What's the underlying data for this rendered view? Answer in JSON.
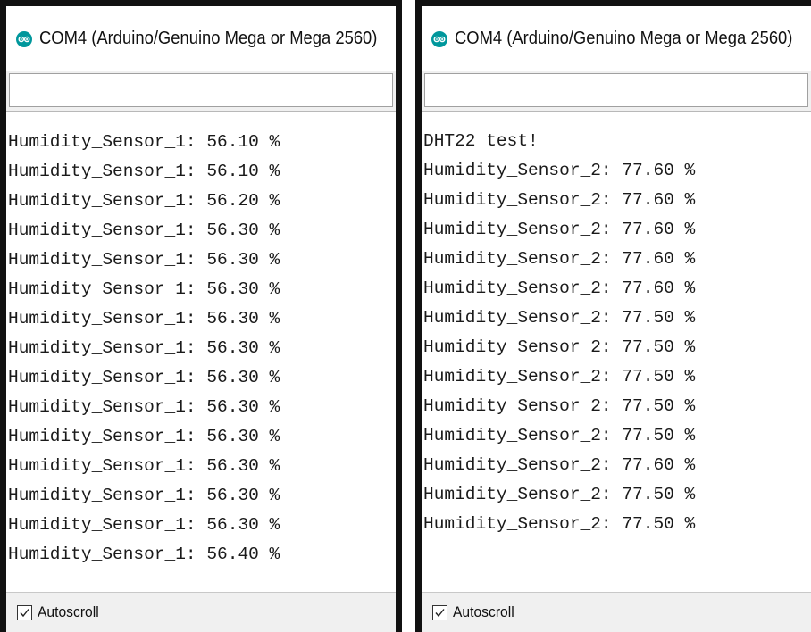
{
  "windows": [
    {
      "title": "COM4 (Arduino/Genuino Mega or Mega 2560)",
      "send_value": "",
      "autoscroll_label": "Autoscroll",
      "autoscroll_checked": true,
      "partial_line": "Humidity_Sensor_1: 56.10 %",
      "lines": [
        "Humidity_Sensor_1: 56.10 %",
        "Humidity_Sensor_1: 56.10 %",
        "Humidity_Sensor_1: 56.20 %",
        "Humidity_Sensor_1: 56.30 %",
        "Humidity_Sensor_1: 56.30 %",
        "Humidity_Sensor_1: 56.30 %",
        "Humidity_Sensor_1: 56.30 %",
        "Humidity_Sensor_1: 56.30 %",
        "Humidity_Sensor_1: 56.30 %",
        "Humidity_Sensor_1: 56.30 %",
        "Humidity_Sensor_1: 56.30 %",
        "Humidity_Sensor_1: 56.30 %",
        "Humidity_Sensor_1: 56.30 %",
        "Humidity_Sensor_1: 56.30 %",
        "Humidity_Sensor_1: 56.40 %"
      ]
    },
    {
      "title": "COM4 (Arduino/Genuino Mega or Mega 2560)",
      "send_value": "",
      "autoscroll_label": "Autoscroll",
      "autoscroll_checked": true,
      "lines": [
        "DHT22 test!",
        "Humidity_Sensor_2: 77.60 %",
        "Humidity_Sensor_2: 77.60 %",
        "Humidity_Sensor_2: 77.60 %",
        "Humidity_Sensor_2: 77.60 %",
        "Humidity_Sensor_2: 77.60 %",
        "Humidity_Sensor_2: 77.50 %",
        "Humidity_Sensor_2: 77.50 %",
        "Humidity_Sensor_2: 77.50 %",
        "Humidity_Sensor_2: 77.50 %",
        "Humidity_Sensor_2: 77.50 %",
        "Humidity_Sensor_2: 77.60 %",
        "Humidity_Sensor_2: 77.50 %",
        "Humidity_Sensor_2: 77.50 %"
      ]
    }
  ],
  "colors": {
    "arduino_teal": "#00979c",
    "frame": "#111111",
    "panel": "#f0f0f0"
  },
  "icons": {
    "app": "arduino-icon",
    "check": "checkmark-icon"
  }
}
